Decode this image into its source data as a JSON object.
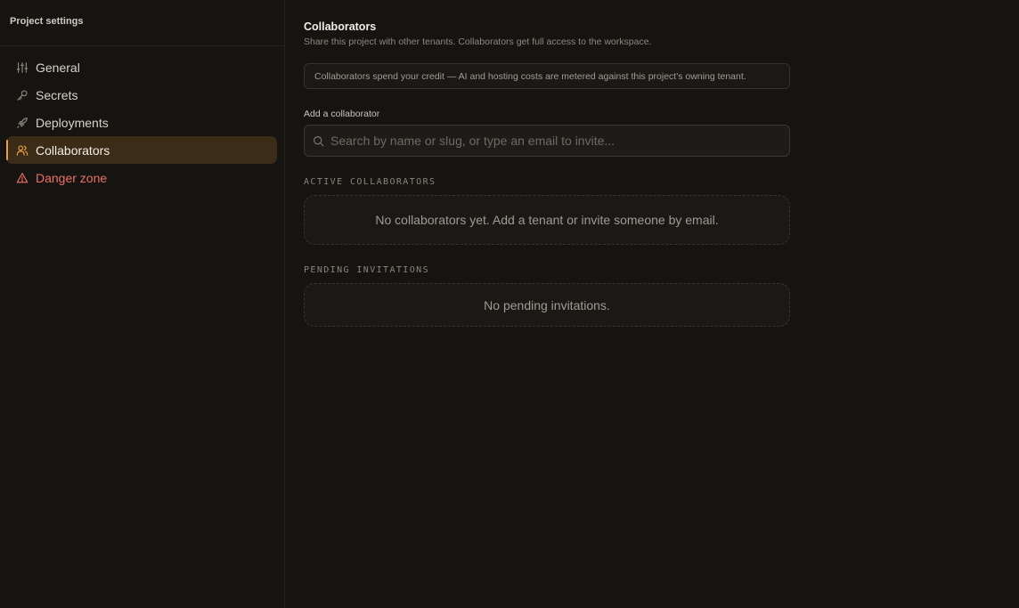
{
  "sidebar": {
    "title": "Project settings",
    "items": [
      {
        "label": "General",
        "icon": "sliders-icon"
      },
      {
        "label": "Secrets",
        "icon": "key-icon"
      },
      {
        "label": "Deployments",
        "icon": "rocket-icon"
      },
      {
        "label": "Collaborators",
        "icon": "users-icon",
        "active": true
      },
      {
        "label": "Danger zone",
        "icon": "warning-icon",
        "danger": true
      }
    ]
  },
  "main": {
    "title": "Collaborators",
    "subtitle": "Share this project with other tenants. Collaborators get full access to the workspace.",
    "notice": "Collaborators spend your credit — AI and hosting costs are metered against this project's owning tenant.",
    "add_label": "Add a collaborator",
    "search": {
      "placeholder": "Search by name or slug, or type an email to invite...",
      "value": ""
    },
    "active_section": {
      "label": "ACTIVE COLLABORATORS",
      "empty": "No collaborators yet. Add a tenant or invite someone by email."
    },
    "pending_section": {
      "label": "PENDING INVITATIONS",
      "empty": "No pending invitations."
    }
  },
  "colors": {
    "background": "#151411",
    "accent": "#e7a045",
    "active_bg": "#3a2c17",
    "danger": "#ee6f66"
  }
}
